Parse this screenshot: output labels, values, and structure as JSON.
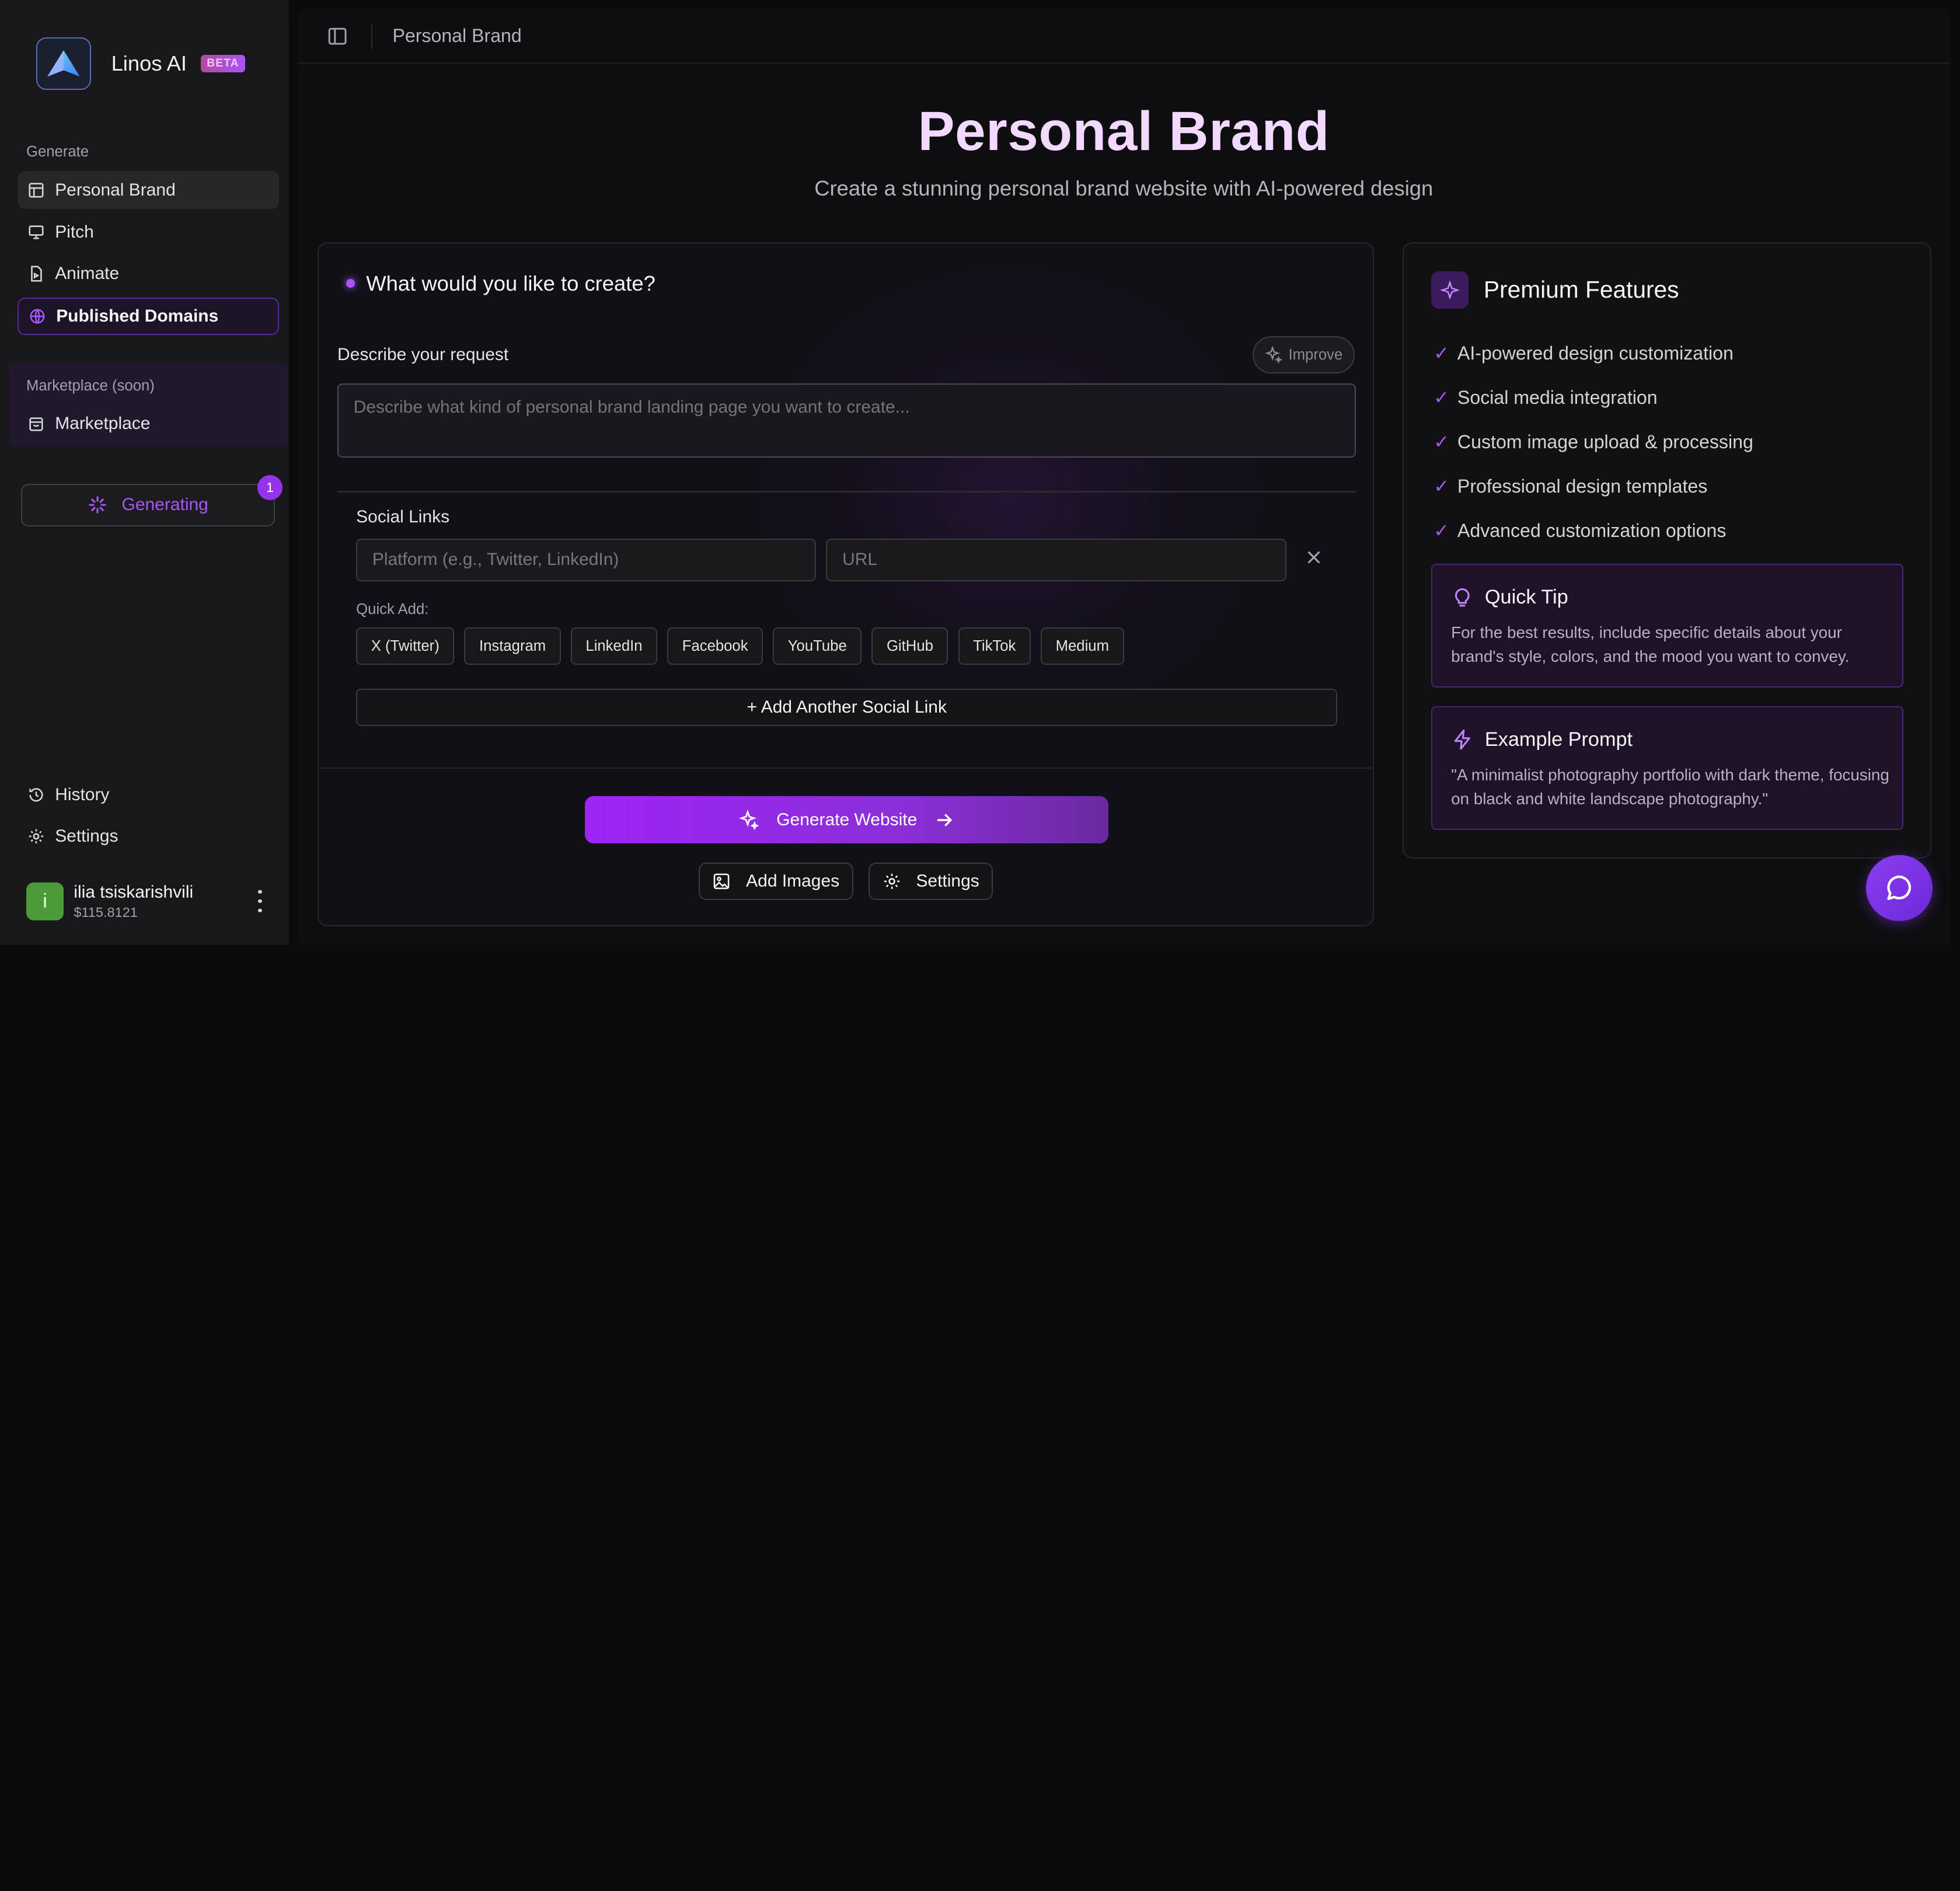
{
  "app": {
    "name": "Linos AI",
    "badge": "BETA"
  },
  "sidebar": {
    "generate_label": "Generate",
    "items": [
      {
        "label": "Personal Brand",
        "icon": "layout-icon"
      },
      {
        "label": "Pitch",
        "icon": "presentation-icon"
      },
      {
        "label": "Animate",
        "icon": "file-video-icon"
      },
      {
        "label": "Published Domains",
        "icon": "globe-icon"
      }
    ],
    "marketplace_label": "Marketplace (soon)",
    "marketplace_item": "Marketplace",
    "generating": {
      "label": "Generating",
      "count": "1"
    },
    "history": "History",
    "settings": "Settings",
    "user": {
      "initial": "i",
      "name": "ilia tsiskarishvili",
      "balance": "$115.8121"
    }
  },
  "topbar": {
    "breadcrumb": "Personal Brand"
  },
  "hero": {
    "title": "Personal Brand",
    "subtitle": "Create a stunning personal brand website with AI-powered design"
  },
  "form": {
    "heading": "What would you like to create?",
    "describe_label": "Describe your request",
    "improve_label": "Improve",
    "describe_placeholder": "Describe what kind of personal brand landing page you want to create...",
    "social_label": "Social Links",
    "platform_placeholder": "Platform (e.g., Twitter, LinkedIn)",
    "url_placeholder": "URL",
    "quick_add_label": "Quick Add:",
    "quick_add": [
      "X (Twitter)",
      "Instagram",
      "LinkedIn",
      "Facebook",
      "YouTube",
      "GitHub",
      "TikTok",
      "Medium"
    ],
    "add_social": "+ Add Another Social Link",
    "generate_button": "Generate Website",
    "add_images": "Add Images",
    "settings": "Settings"
  },
  "premium": {
    "title": "Premium Features",
    "features": [
      "AI-powered design customization",
      "Social media integration",
      "Custom image upload & processing",
      "Professional design templates",
      "Advanced customization options"
    ],
    "tip": {
      "title": "Quick Tip",
      "body": "For the best results, include specific details about your brand's style, colors, and the mood you want to convey."
    },
    "example": {
      "title": "Example Prompt",
      "body": "\"A minimalist photography portfolio with dark theme, focusing on black and white landscape photography.\""
    }
  },
  "colors": {
    "accent": "#a855f7",
    "cta": "#9d24f5",
    "title": "#f3d9ff",
    "background": "#0b0b0d"
  }
}
